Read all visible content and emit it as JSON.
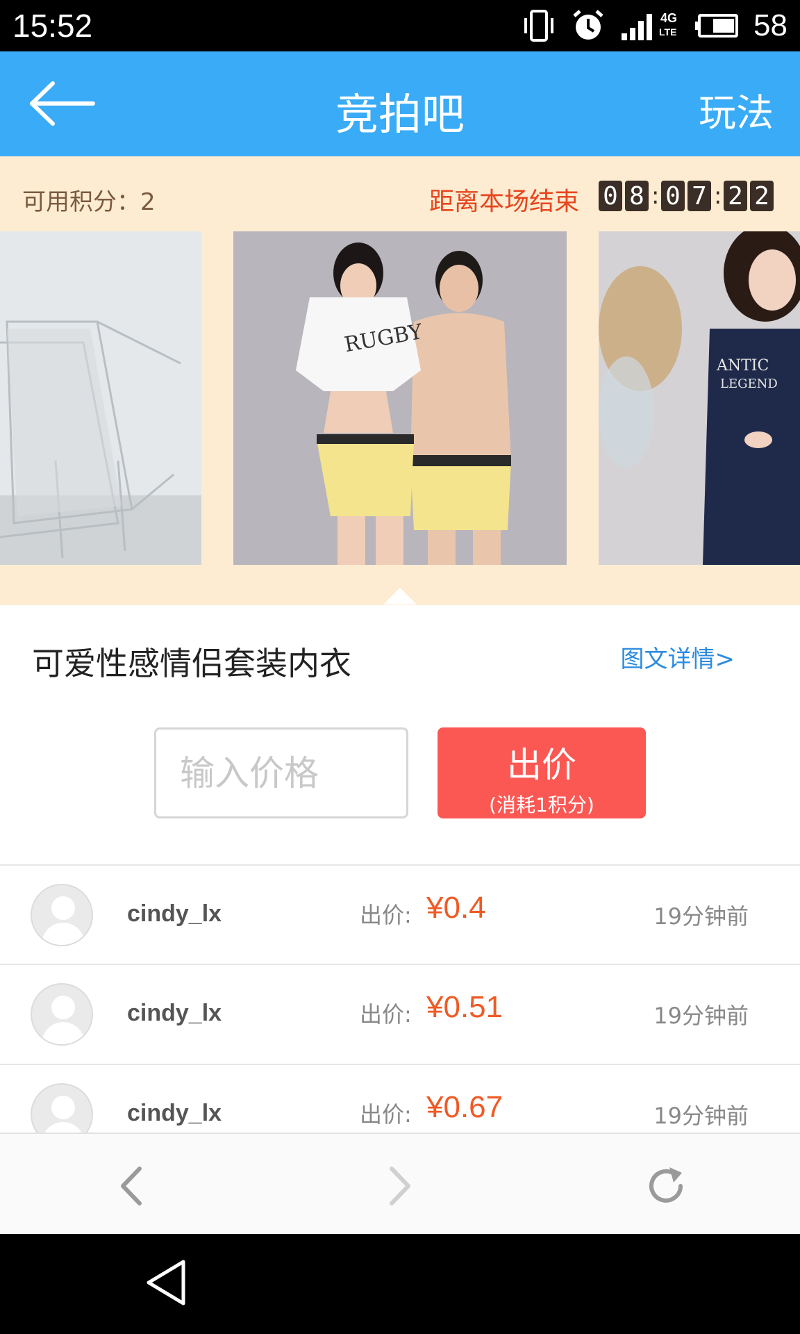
{
  "status_bar": {
    "time": "15:52",
    "network": "4G",
    "network_sub": "LTE",
    "battery": "58",
    "icons": [
      "vibrate-icon",
      "alarm-icon",
      "signal-icon",
      "battery-icon"
    ]
  },
  "app_bar": {
    "title": "竞拍吧",
    "rules_label": "玩法",
    "background": "#3aabf6"
  },
  "info_bar": {
    "points_label": "可用积分：2",
    "countdown_label": "距离本场结束",
    "countdown_digits": [
      "0",
      "8",
      "0",
      "7",
      "2",
      "2"
    ]
  },
  "product": {
    "name": "可爱性感情侣套装内衣",
    "detail_link": "图文详情>"
  },
  "bid": {
    "input_placeholder": "输入价格",
    "button_label": "出价",
    "button_sub": "(消耗1积分)",
    "button_color": "#fc5853"
  },
  "bids": [
    {
      "user": "cindy_lx",
      "label": "出价:",
      "value": "¥0.4",
      "time": "19分钟前"
    },
    {
      "user": "cindy_lx",
      "label": "出价:",
      "value": "¥0.51",
      "time": "19分钟前"
    },
    {
      "user": "cindy_lx",
      "label": "出价:",
      "value": "¥0.67",
      "time": "19分钟前"
    }
  ],
  "colors": {
    "accent_price": "#ef5a25",
    "link": "#2b8be0",
    "info_bg": "#fdecd1"
  }
}
